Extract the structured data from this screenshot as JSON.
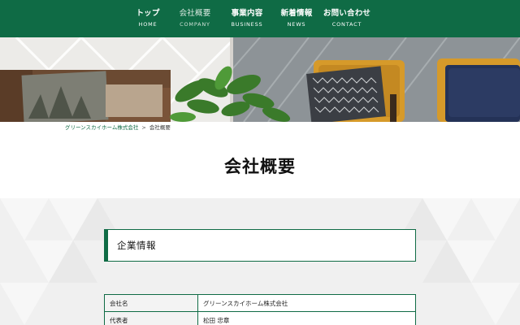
{
  "nav": {
    "items": [
      {
        "jp": "トップ",
        "en": "HOME"
      },
      {
        "jp": "会社概要",
        "en": "COMPANY"
      },
      {
        "jp": "事業内容",
        "en": "BUSINESS"
      },
      {
        "jp": "新着情報",
        "en": "NEWS"
      },
      {
        "jp": "お問い合わせ",
        "en": "CONTACT"
      }
    ]
  },
  "breadcrumb": {
    "home": "グリーンスカイホーム株式会社",
    "separator": ">",
    "current": "会社概要"
  },
  "page": {
    "title": "会社概要"
  },
  "section": {
    "heading": "企業情報"
  },
  "company_table": {
    "rows": [
      {
        "label": "会社名",
        "value": "グリーンスカイホーム株式会社"
      },
      {
        "label": "代表者",
        "value": "松田 忠章"
      }
    ]
  },
  "colors": {
    "brand_green": "#0f6b45",
    "content_bg": "#f0f0f0"
  }
}
